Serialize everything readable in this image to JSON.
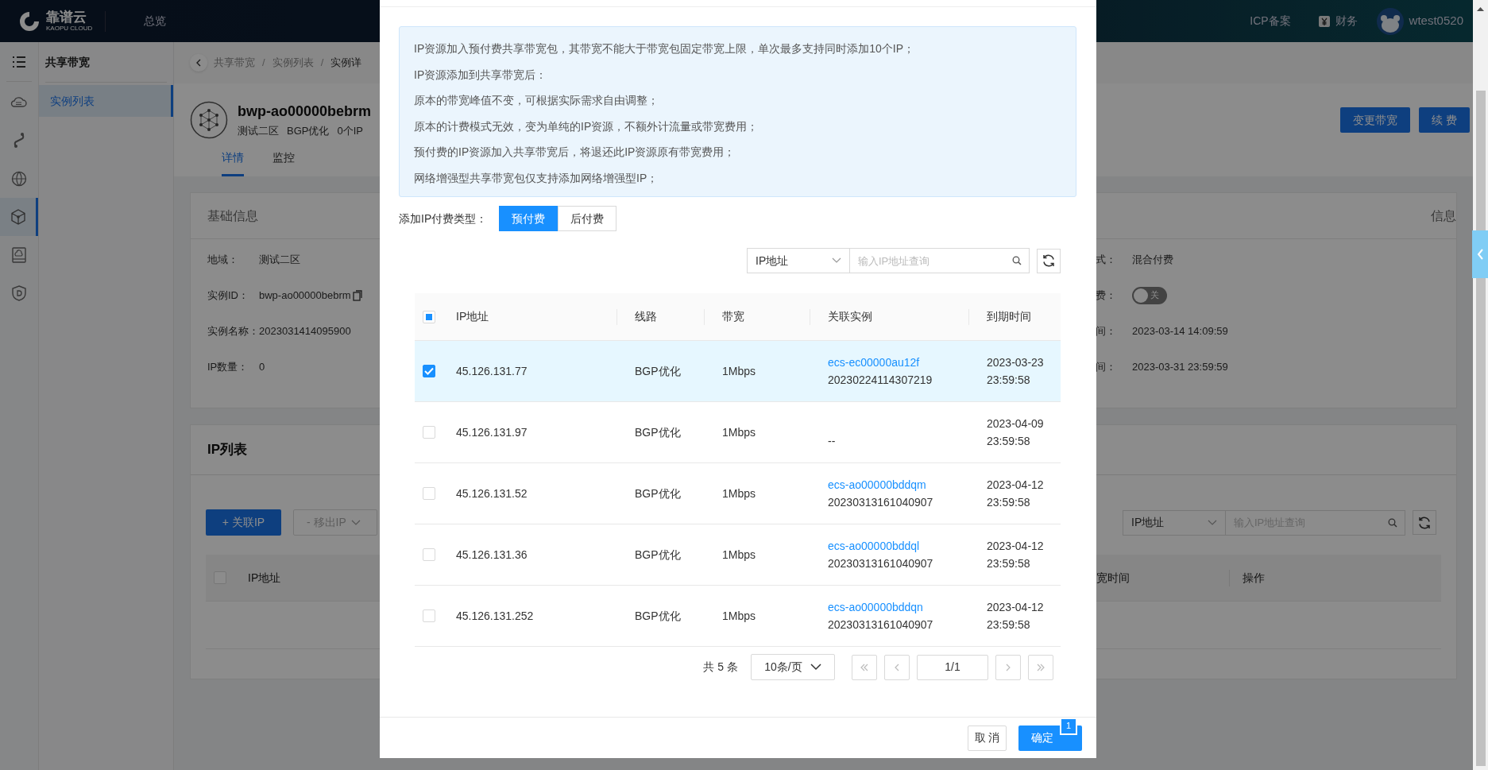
{
  "header": {
    "logo_text": "靠谱云",
    "logo_subtext": "KAOPU CLOUD",
    "nav": [
      "总览"
    ],
    "right_links": [
      {
        "label": "ICP备案",
        "kind": "text"
      },
      {
        "label": "财务",
        "kind": "finance"
      }
    ],
    "username": "wtest0520"
  },
  "icon_sidebar": [
    {
      "kind": "menu",
      "selected": false
    },
    {
      "kind": "cloud",
      "selected": false
    },
    {
      "kind": "link",
      "selected": false
    },
    {
      "kind": "globe",
      "selected": false
    },
    {
      "kind": "network",
      "selected": true
    },
    {
      "kind": "storage",
      "selected": false
    },
    {
      "kind": "shield",
      "selected": false
    }
  ],
  "sub_sidebar": {
    "title": "共享带宽",
    "items": [
      {
        "label": "实例列表",
        "selected": true
      }
    ]
  },
  "breadcrumb": [
    {
      "kind": "link",
      "label": "共享带宽"
    },
    {
      "kind": "separator",
      "label": "/"
    },
    {
      "kind": "link",
      "label": "实例列表"
    },
    {
      "kind": "separator",
      "label": "/"
    },
    {
      "kind": "current",
      "label": "实例详"
    }
  ],
  "instance": {
    "name": "bwp-ao00000bebrm",
    "tags": [
      "测试二区",
      "BGP优化",
      "0个IP"
    ],
    "tabs": [
      {
        "label": "详情",
        "selected": true
      },
      {
        "label": "监控",
        "selected": false
      }
    ],
    "actions": [
      "变更带宽",
      "续 费"
    ]
  },
  "basic_info": {
    "title": "基础信息",
    "right_title": "信息",
    "left_fields": [
      {
        "label": "地域：",
        "value": "测试二区",
        "kind": "text"
      },
      {
        "label": "实例ID：",
        "value": "bwp-ao00000bebrm",
        "kind": "copy"
      },
      {
        "label": "实例名称：",
        "value": "2023031414095900",
        "kind": "text"
      },
      {
        "label": "IP数量：",
        "value": "0",
        "kind": "text"
      }
    ],
    "right_fields": [
      {
        "label": "式：",
        "value": "混合付费",
        "kind": "text"
      },
      {
        "label": "费：",
        "value": "关",
        "kind": "toggle",
        "on": false
      },
      {
        "label": "间：",
        "value": "2023-03-14 14:09:59",
        "kind": "text"
      },
      {
        "label": "间：",
        "value": "2023-03-31 23:59:59",
        "kind": "text"
      }
    ]
  },
  "ip_list": {
    "title": "IP列表",
    "buttons": [
      {
        "label": "+ 关联IP",
        "kind": "primary",
        "disabled": false
      },
      {
        "label": "- 移出IP",
        "kind": "dropdown",
        "disabled": true
      }
    ],
    "filter": {
      "field": "IP地址",
      "placeholder": "输入IP地址查询"
    },
    "header_checked": false,
    "columns_left": [
      "IP地址"
    ],
    "columns_right": [
      "宽时间",
      "操作"
    ]
  },
  "modal": {
    "notice": [
      "IP资源加入预付费共享带宽包，其带宽不能大于带宽包固定带宽上限，单次最多支持同时添加10个IP；",
      "IP资源添加到共享带宽后：",
      "原本的带宽峰值不变，可根据实际需求自由调整；",
      "原本的计费模式无效，变为单纯的IP资源，不额外计流量或带宽费用；",
      "预付费的IP资源加入共享带宽后，将退还此IP资源原有带宽费用；",
      "网络增强型共享带宽包仅支持添加网络增强型IP；"
    ],
    "pay_type_label": "添加IP付费类型：",
    "pay_types": [
      {
        "label": "预付费",
        "selected": true
      },
      {
        "label": "后付费",
        "selected": false
      }
    ],
    "filter": {
      "field": "IP地址",
      "placeholder": "输入IP地址查询"
    },
    "header_indeterminate": true,
    "columns": [
      "IP地址",
      "线路",
      "带宽",
      "关联实例",
      "到期时间"
    ],
    "rows": [
      {
        "checked": true,
        "ip": "45.126.131.77",
        "line": "BGP优化",
        "bandwidth": "1Mbps",
        "instance_link": "ecs-ec00000au12f",
        "instance_id": "20230224114307219",
        "expire_date": "2023-03-23",
        "expire_time": "23:59:58"
      },
      {
        "checked": false,
        "ip": "45.126.131.97",
        "line": "BGP优化",
        "bandwidth": "1Mbps",
        "instance_id": "--",
        "expire_date": "2023-04-09",
        "expire_time": "23:59:58"
      },
      {
        "checked": false,
        "ip": "45.126.131.52",
        "line": "BGP优化",
        "bandwidth": "1Mbps",
        "instance_link": "ecs-ao00000bddqm",
        "instance_id": "20230313161040907",
        "expire_date": "2023-04-12",
        "expire_time": "23:59:58"
      },
      {
        "checked": false,
        "ip": "45.126.131.36",
        "line": "BGP优化",
        "bandwidth": "1Mbps",
        "instance_link": "ecs-ao00000bddql",
        "instance_id": "20230313161040907",
        "expire_date": "2023-04-12",
        "expire_time": "23:59:58"
      },
      {
        "checked": false,
        "ip": "45.126.131.252",
        "line": "BGP优化",
        "bandwidth": "1Mbps",
        "instance_link": "ecs-ao00000bddqn",
        "instance_id": "20230313161040907",
        "expire_date": "2023-04-12",
        "expire_time": "23:59:58"
      }
    ],
    "pagination": {
      "total": "共 5 条",
      "page_size": "10条/页",
      "page": "1/1"
    },
    "footer": {
      "cancel": "取 消",
      "ok": "确定",
      "badge": "1"
    }
  }
}
